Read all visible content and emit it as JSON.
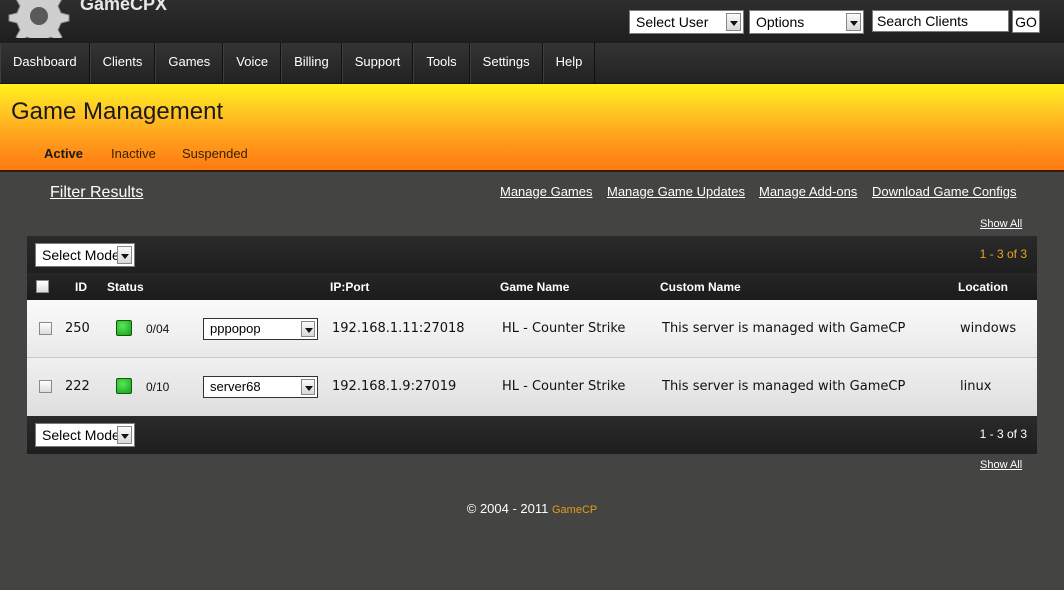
{
  "app": {
    "name": "GameCPX"
  },
  "topbar": {
    "select_user": "Select User",
    "options": "Options",
    "search_value": "Search Clients",
    "go_label": "GO"
  },
  "nav": [
    "Dashboard",
    "Clients",
    "Games",
    "Voice",
    "Billing",
    "Support",
    "Tools",
    "Settings",
    "Help"
  ],
  "header": {
    "title": "Game Management",
    "tabs": [
      "Active",
      "Inactive",
      "Suspended"
    ]
  },
  "actions": {
    "filter": "Filter Results",
    "links": [
      "Manage Games",
      "Manage Game Updates",
      "Manage Add-ons",
      "Download Game Configs"
    ],
    "show_all": "Show All"
  },
  "table": {
    "mode_select": "Select Mode",
    "pager": "1 - 3 of 3",
    "columns": [
      "ID",
      "Status",
      "IP:Port",
      "Game Name",
      "Custom Name",
      "Location"
    ],
    "rows": [
      {
        "id": "250",
        "slots": "0/04",
        "name_select": "pppopop",
        "ip": "192.168.1.11:27018",
        "game": "HL - Counter Strike",
        "custom": "This server is managed with GameCP",
        "location": "windows"
      },
      {
        "id": "222",
        "slots": "0/10",
        "name_select": "server68",
        "ip": "192.168.1.9:27019",
        "game": "HL - Counter Strike",
        "custom": "This server is managed with GameCP",
        "location": "linux"
      }
    ]
  },
  "footer": {
    "copyright": "© 2004 - 2011 ",
    "brand": "GameCP"
  },
  "colors": {
    "accent": "#ff8c1a",
    "pager_highlight": "#f0a020",
    "status_online": "#2ec42e"
  }
}
